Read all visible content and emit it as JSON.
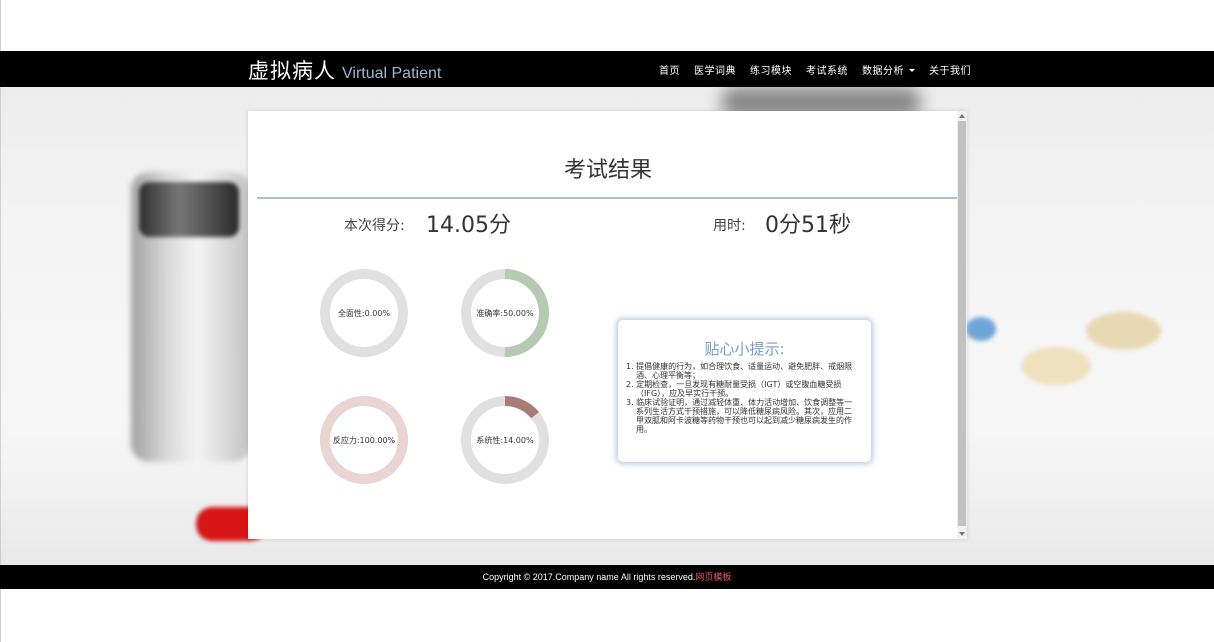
{
  "navbar": {
    "brand_cn": "虚拟病人",
    "brand_en": "Virtual Patient",
    "items": [
      {
        "label": "首页"
      },
      {
        "label": "医学词典"
      },
      {
        "label": "练习模块"
      },
      {
        "label": "考试系统"
      },
      {
        "label": "数据分析"
      },
      {
        "label": "关于我们"
      }
    ]
  },
  "panel": {
    "title": "考试结果",
    "score_label": "本次得分:",
    "score_value": "14.05分",
    "time_label": "用时:",
    "time_value": "0分51秒"
  },
  "metrics": [
    {
      "label": "全面性:0.00%",
      "value": 0.0,
      "color": "#a7c1a3"
    },
    {
      "label": "准确率:50.00%",
      "value": 50.0,
      "color": "#b5c9b3"
    },
    {
      "label": "反应力:100.00%",
      "value": 100.0,
      "color": "#ebd4d4"
    },
    {
      "label": "系统性:14.00%",
      "value": 14.0,
      "color": "#a87c74"
    }
  ],
  "tips": {
    "title": "贴心小提示:",
    "items": [
      "1. 提倡健康的行为，如合理饮食、适量运动、避免肥胖、戒烟限酒、心理平衡等；",
      "2. 定期检查，一旦发现有糖耐量受损（IGT）或空腹血糖受损（IFG），应及早实行干预。",
      "3. 临床试验证明，通过减轻体重、体力活动增加、饮食调整等一系列生活方式干预措施，可以降低糖尿病风险。其次，应用二甲双胍和阿卡波糖等药物干预也可以起到减少糖尿病发生的作用。"
    ]
  },
  "footer": {
    "text": "Copyright © 2017.Company name All rights reserved.",
    "link": "网页模板"
  },
  "colors": {
    "track": "#e0e0e0",
    "accent_blue": "#6f9fc8",
    "divider": "#a6c2d0"
  }
}
